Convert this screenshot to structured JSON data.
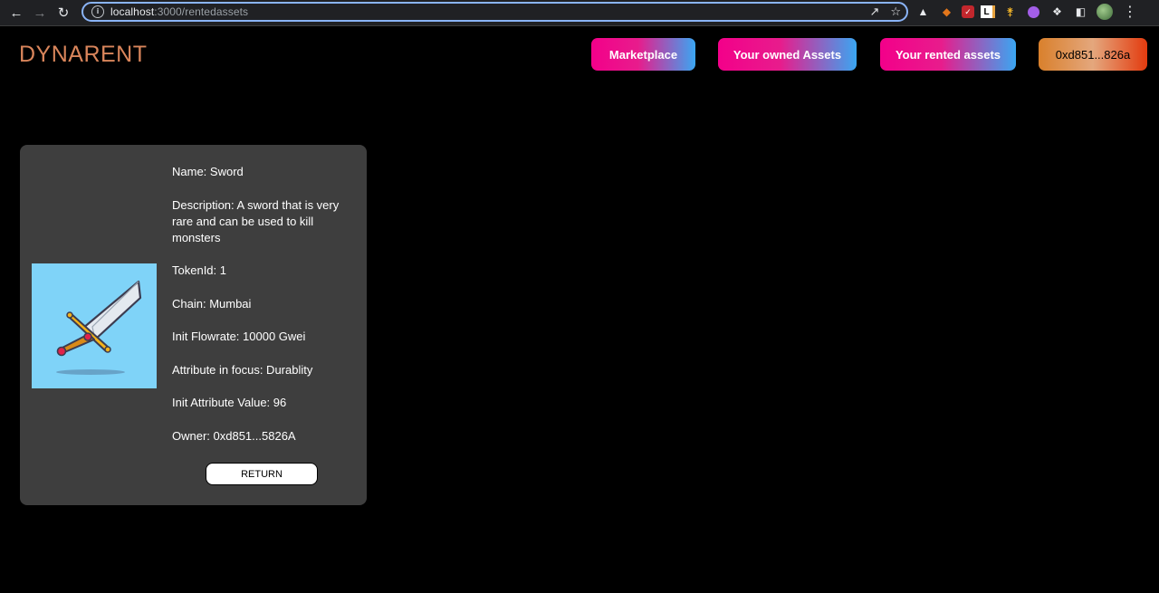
{
  "browser": {
    "url_host": "localhost",
    "url_path": ":3000/rentedassets"
  },
  "app": {
    "logo": "DYNARENT",
    "nav": {
      "marketplace": "Marketplace",
      "owned": "Your owned Assets",
      "rented": "Your rented assets",
      "wallet": "0xd851...826a"
    }
  },
  "asset": {
    "name": "Name: Sword",
    "description": "Description: A sword that is very rare and can be used to kill monsters",
    "token_id": "TokenId: 1",
    "chain": "Chain: Mumbai",
    "init_flowrate": "Init Flowrate: 10000 Gwei",
    "attribute_focus": "Attribute in focus: Durablity",
    "init_attribute_value": "Init Attribute Value: 96",
    "owner": "Owner: 0xd851...5826A",
    "return_label": "RETURN"
  },
  "colors": {
    "logo": "#d9855b",
    "card_bg": "#3e3e3e",
    "image_bg": "#7fd3f8"
  }
}
